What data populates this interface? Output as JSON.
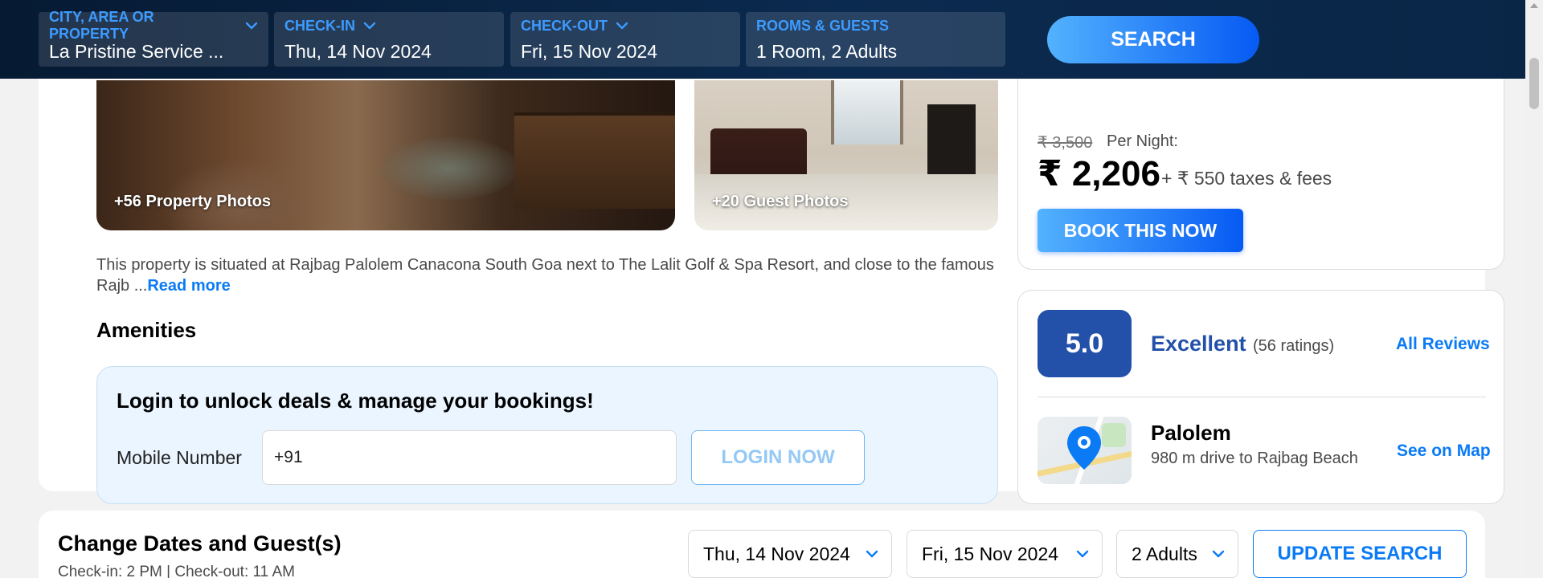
{
  "search": {
    "city": {
      "label": "CITY, AREA OR PROPERTY",
      "value": "La Pristine Service ..."
    },
    "checkin": {
      "label": "CHECK-IN",
      "value": "Thu, 14 Nov 2024"
    },
    "checkout": {
      "label": "CHECK-OUT",
      "value": "Fri, 15 Nov 2024"
    },
    "rooms": {
      "label": "ROOMS & GUESTS",
      "value": "1 Room, 2 Adults"
    },
    "button": "SEARCH"
  },
  "photos": {
    "property_caption": "+56 Property Photos",
    "guest_caption": "+20 Guest Photos"
  },
  "description": {
    "text": "This property is situated at Rajbag Palolem Canacona South Goa next to The Lalit Golf & Spa Resort, and close to the famous Rajb ...",
    "read_more": "Read more"
  },
  "amenities": {
    "title": "Amenities"
  },
  "login": {
    "title": "Login to unlock deals & manage your bookings!",
    "mobile_label": "Mobile Number",
    "mobile_value": "+91",
    "button": "LOGIN NOW"
  },
  "price": {
    "original": "₹ 3,500",
    "per_night": "Per Night:",
    "current": "₹ 2,206",
    "taxes": "+ ₹ 550 taxes & fees",
    "book_button": "BOOK THIS NOW"
  },
  "rating": {
    "score": "5.0",
    "label": "Excellent",
    "count": "(56 ratings)",
    "all_reviews": "All Reviews"
  },
  "location": {
    "name": "Palolem",
    "distance": "980 m drive to Rajbag Beach",
    "see_map": "See on Map"
  },
  "change": {
    "title": "Change Dates and Guest(s)",
    "subtitle": "Check-in: 2 PM | Check-out: 11 AM",
    "checkin": "Thu, 14 Nov 2024",
    "checkout": "Fri, 15 Nov 2024",
    "guests": "2 Adults",
    "update_button": "UPDATE SEARCH"
  },
  "icons": {
    "chevron": "chevron-down-icon",
    "map_pin": "map-pin-icon"
  },
  "colors": {
    "header_bg": "#0b2a4f",
    "accent_blue": "#0a7bf5",
    "rating_blue": "#2350a8",
    "label_blue": "#3d9bff"
  }
}
